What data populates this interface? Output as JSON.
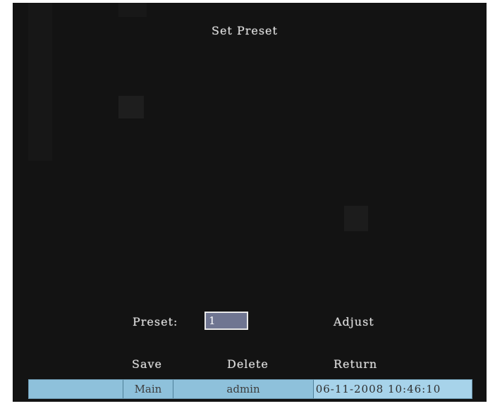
{
  "title": "Set Preset",
  "preset": {
    "label": "Preset:",
    "value": "1"
  },
  "buttons": {
    "adjust": "Adjust",
    "save": "Save",
    "delete": "Delete",
    "return": "Return"
  },
  "status_bar": {
    "menu": "Main",
    "user": "admin",
    "datetime": "06-11-2008 10:46:10"
  },
  "colors": {
    "screen_background": "#131313",
    "osd_text": "#dcdcdc",
    "status_bar": "#8ec1db",
    "input_fill": "#6f7591"
  }
}
